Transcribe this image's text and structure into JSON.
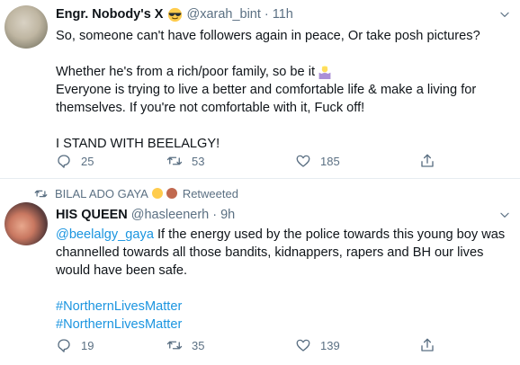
{
  "tweet1": {
    "name": "Engr. Nobody's X",
    "handle": "@xarah_bint",
    "separator": "·",
    "time": "11h",
    "lines": [
      "So, someone can't have followers again in peace, Or take posh pictures?",
      "",
      "Whether he's from a rich/poor family, so be it",
      "Everyone is trying to live a better and comfortable life & make a living for",
      "themselves. If you're not comfortable with it, Fuck off!",
      "",
      "I STAND WITH BEELALGY!"
    ],
    "actions": {
      "replies": "25",
      "retweets": "53",
      "likes": "185"
    }
  },
  "tweet2": {
    "retweeted_by": "BILAL ADO GAYA",
    "retweeted_label": "Retweeted",
    "name": "HIS QUEEN",
    "handle": "@hasleenerh",
    "separator": "·",
    "time": "9h",
    "mention": "@beelalgy_gaya",
    "text_first": " If the energy used by the police towards this young boy was",
    "lines": [
      "channelled towards all those bandits, kidnappers, rapers and BH our lives",
      "would have been safe."
    ],
    "hashtags": [
      "#NorthernLivesMatter",
      "#NorthernLivesMatter"
    ],
    "actions": {
      "replies": "19",
      "retweets": "35",
      "likes": "139"
    }
  },
  "icons": {
    "reply": "reply-icon",
    "retweet": "retweet-icon",
    "like": "heart-icon",
    "share": "share-icon",
    "caret": "chevron-down-icon"
  },
  "colors": {
    "link": "#1b95e0",
    "muted": "#5b7083",
    "text": "#0f1419"
  }
}
